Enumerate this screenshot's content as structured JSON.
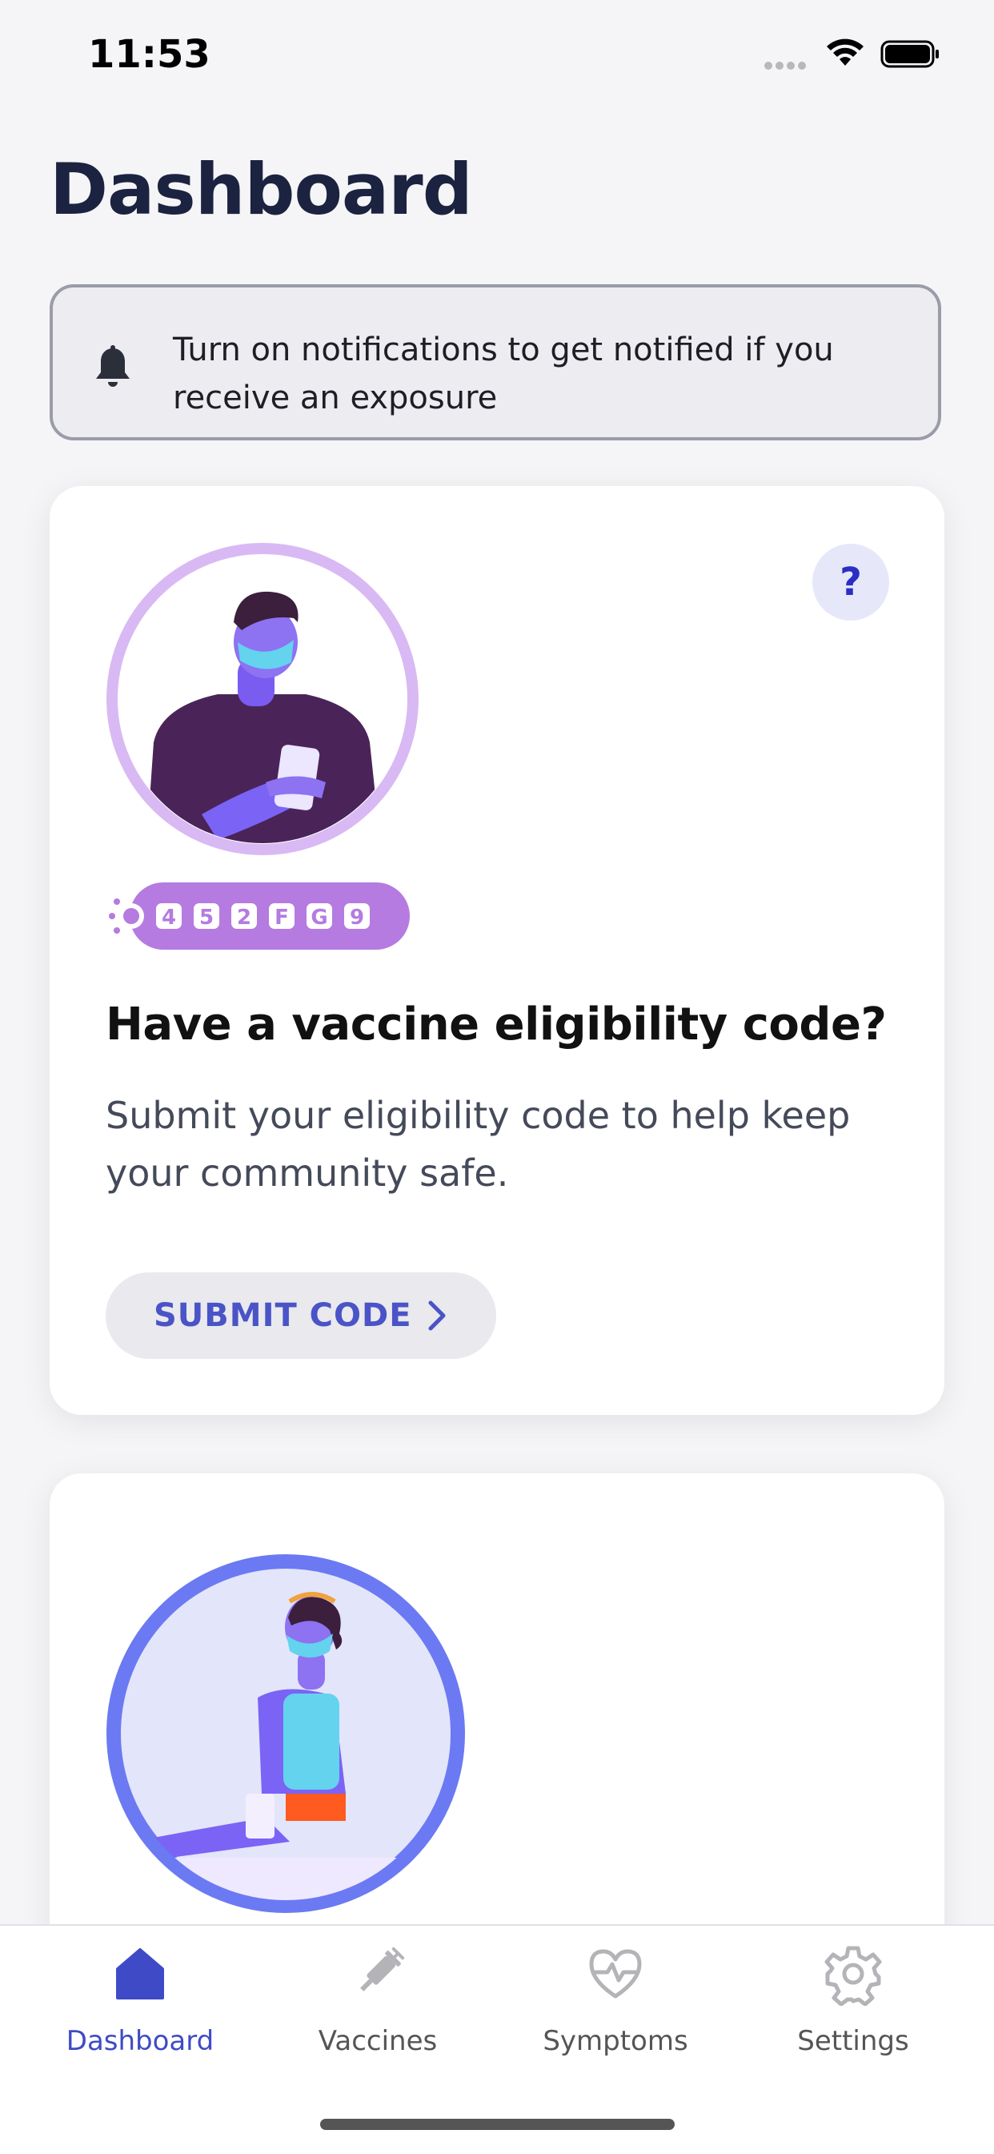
{
  "status_bar": {
    "time": "11:53"
  },
  "page_title": "Dashboard",
  "notification_banner": {
    "text": "Turn on notifications to get notified if you receive an exposure",
    "icon": "bell-icon"
  },
  "eligibility_card": {
    "help_label": "?",
    "code_chars": [
      "4",
      "5",
      "2",
      "F",
      "G",
      "9"
    ],
    "title": "Have a vaccine eligibility code?",
    "body": "Submit your eligibility code to help keep your community safe.",
    "button_label": "SUBMIT CODE"
  },
  "tab_bar": {
    "tabs": [
      {
        "label": "Dashboard",
        "icon": "home-icon",
        "active": true
      },
      {
        "label": "Vaccines",
        "icon": "syringe-icon",
        "active": false
      },
      {
        "label": "Symptoms",
        "icon": "heart-pulse-icon",
        "active": false
      },
      {
        "label": "Settings",
        "icon": "gear-icon",
        "active": false
      }
    ]
  },
  "colors": {
    "accent": "#3f4bc6",
    "title": "#1b2340",
    "pill_purple": "#b57be0",
    "ring_blue": "#6b7af2"
  }
}
